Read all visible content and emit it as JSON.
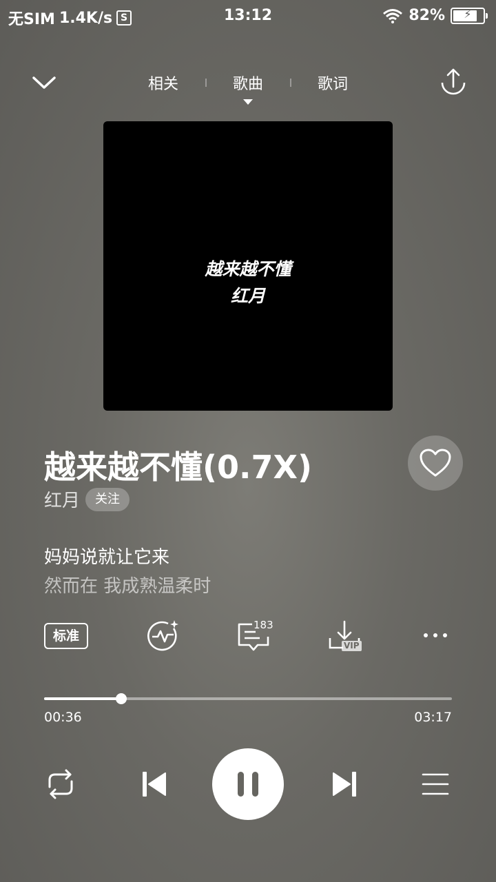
{
  "status_bar": {
    "carrier": "无SIM",
    "speed": "1.4K/s",
    "badge": "S",
    "time": "13:12",
    "battery": "82%",
    "battery_level": 0.82
  },
  "header": {
    "tabs": [
      "相关",
      "歌曲",
      "歌词"
    ],
    "active_tab": "歌曲"
  },
  "cover": {
    "title": "越来越不懂",
    "artist": "红月"
  },
  "song": {
    "title": "越来越不懂(0.7X)",
    "artist": "红月",
    "follow_label": "关注"
  },
  "lyrics": {
    "current": "妈妈说就让它来",
    "next": "然而在 我成熟温柔时"
  },
  "tools": {
    "quality_label": "标准",
    "comment_count": "183",
    "vip_label": "VIP"
  },
  "playback": {
    "current_time": "00:36",
    "total_time": "03:17",
    "progress": 0.19
  },
  "icons": {
    "collapse": "chevron-down-icon",
    "share": "share-icon",
    "like": "heart-icon",
    "effect": "sound-effect-icon",
    "comment": "comment-icon",
    "download": "download-icon",
    "more": "more-icon",
    "loop": "loop-icon",
    "prev": "previous-icon",
    "pause": "pause-icon",
    "next": "next-icon",
    "playlist": "playlist-icon"
  }
}
